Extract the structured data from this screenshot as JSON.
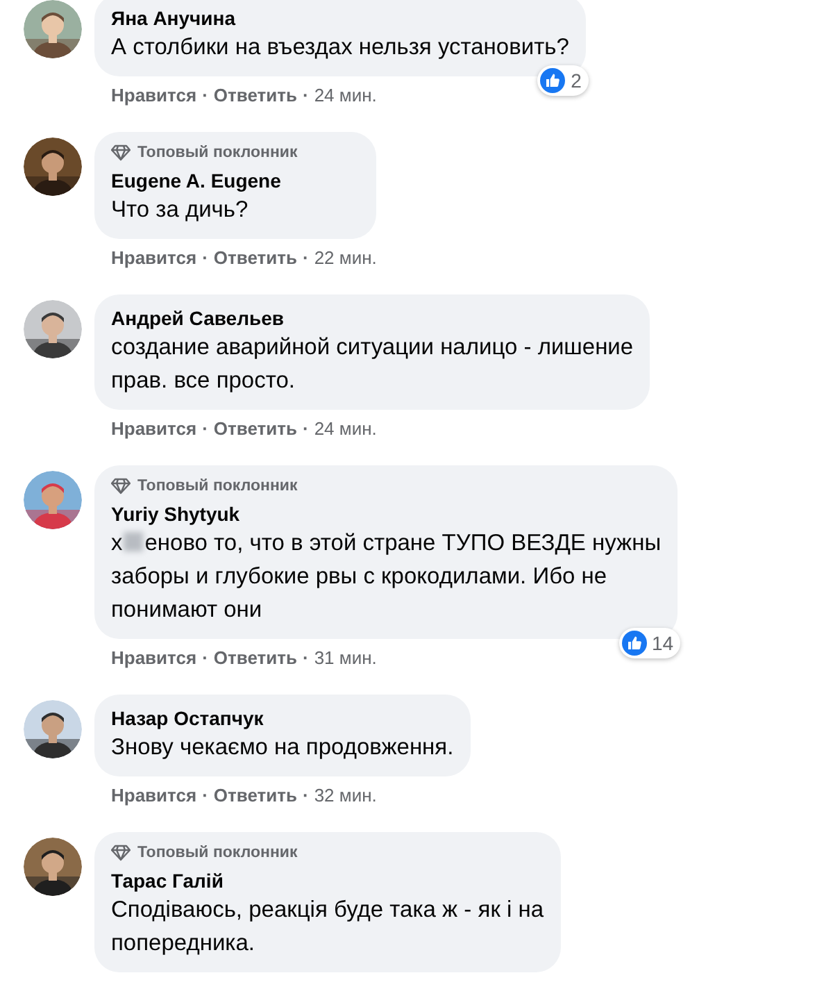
{
  "comments": [
    {
      "name": "Яна Анучина",
      "lines": [
        "А столбики на въездах нельзя установить?"
      ],
      "reactions": "2",
      "meta": [
        {
          "kind": "action",
          "text": "Нравится"
        },
        {
          "kind": "separator",
          "text": "·"
        },
        {
          "kind": "action",
          "text": "Ответить"
        },
        {
          "kind": "separator",
          "text": "·"
        },
        {
          "kind": "time",
          "text": "24 мин."
        }
      ],
      "avatar": {
        "kind": "picture"
      }
    },
    {
      "top_fan": "Топовый поклонник",
      "name": "Eugene A. Eugene",
      "lines": [
        "Что за дичь?"
      ],
      "meta": [
        {
          "kind": "action",
          "text": "Нравится"
        },
        {
          "kind": "separator",
          "text": "·"
        },
        {
          "kind": "action",
          "text": "Ответить"
        },
        {
          "kind": "separator",
          "text": "·"
        },
        {
          "kind": "time",
          "text": "22 мин."
        }
      ],
      "avatar": {
        "kind": "picture"
      }
    },
    {
      "name": "Андрей Савельев",
      "lines": [
        "создание аварийной ситуации налицо - лишение",
        "прав. все просто."
      ],
      "meta": [
        {
          "kind": "action",
          "text": "Нравится"
        },
        {
          "kind": "separator",
          "text": "·"
        },
        {
          "kind": "action",
          "text": "Ответить"
        },
        {
          "kind": "separator",
          "text": "·"
        },
        {
          "kind": "time",
          "text": "24 мин."
        }
      ],
      "avatar": {
        "kind": "picture"
      }
    },
    {
      "top_fan": "Топовый поклонник",
      "name": "Yuriy Shytyuk",
      "censored_lead": "х",
      "lines": [
        "еново то, что в этой стране ТУПО ВЕЗДЕ нужны",
        "заборы и глубокие рвы с крокодилами. Ибо не",
        "понимают они"
      ],
      "reactions": "14",
      "meta": [
        {
          "kind": "action",
          "text": "Нравится"
        },
        {
          "kind": "separator",
          "text": "·"
        },
        {
          "kind": "action",
          "text": "Ответить"
        },
        {
          "kind": "separator",
          "text": "·"
        },
        {
          "kind": "time",
          "text": "31 мин."
        }
      ],
      "avatar": {
        "kind": "picture"
      }
    },
    {
      "name": "Назар Остапчук",
      "lines": [
        "Знову чекаємо на продовження."
      ],
      "meta": [
        {
          "kind": "action",
          "text": "Нравится"
        },
        {
          "kind": "separator",
          "text": "·"
        },
        {
          "kind": "action",
          "text": "Ответить"
        },
        {
          "kind": "separator",
          "text": "·"
        },
        {
          "kind": "time",
          "text": "32 мин."
        }
      ],
      "avatar": {
        "kind": "picture"
      }
    },
    {
      "top_fan": "Топовый поклонник",
      "name": "Тарас Галій",
      "lines": [
        "Сподіваюсь, реакція буде така ж - як і на",
        "попередника."
      ],
      "avatar": {
        "kind": "picture"
      }
    }
  ]
}
